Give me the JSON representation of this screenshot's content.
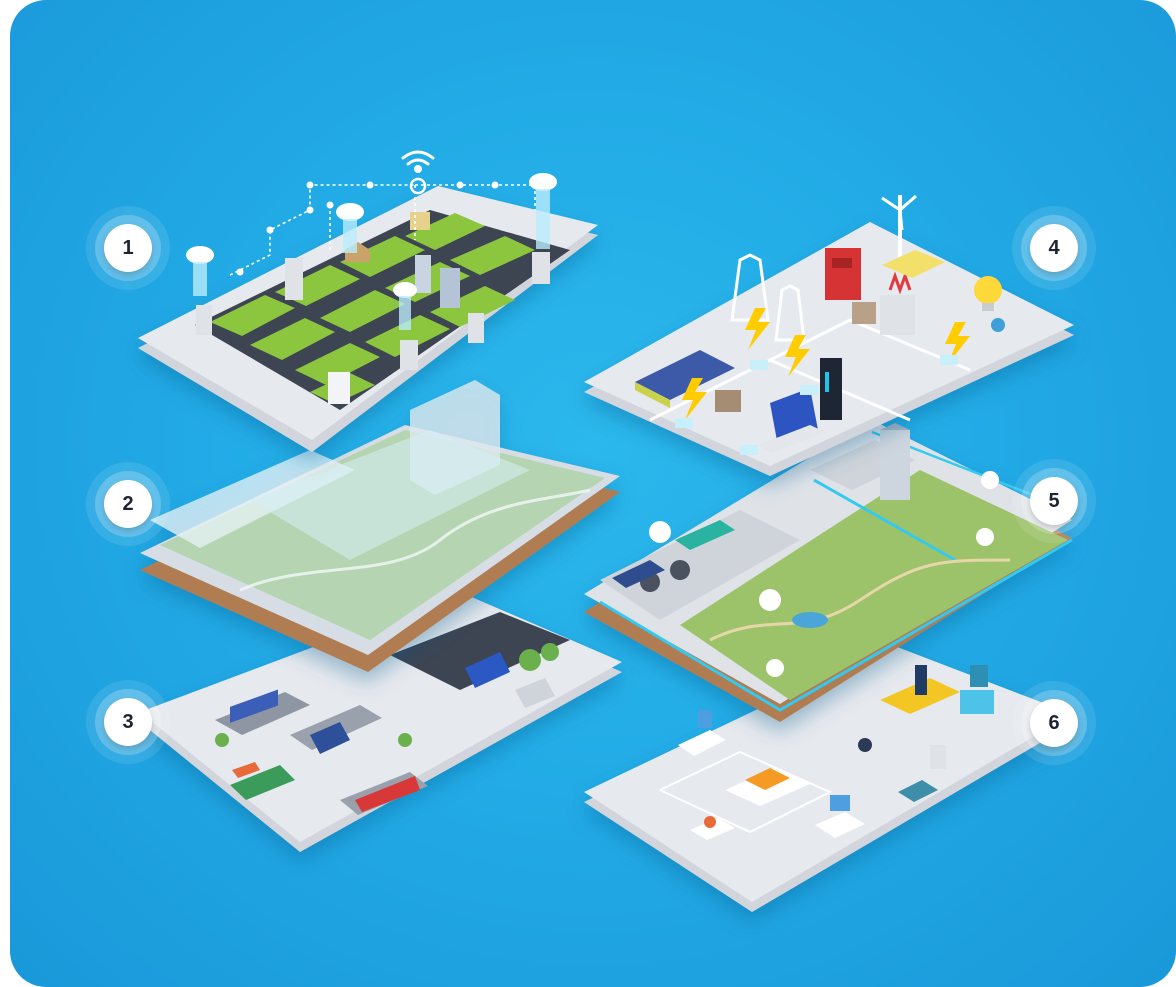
{
  "badges": {
    "b1": "1",
    "b2": "2",
    "b3": "3",
    "b4": "4",
    "b5": "5",
    "b6": "6"
  },
  "colors": {
    "background": "#22abe6",
    "platform": "#e6e9ee",
    "earth": "#b5845a",
    "grass": "#8cc63f",
    "road": "#3d4452",
    "accent_yellow": "#ffcc00",
    "accent_red": "#e03a3a",
    "accent_cyan": "#34c9f0"
  },
  "layers": [
    {
      "id": "1",
      "icon": "smart-city-icon"
    },
    {
      "id": "2",
      "icon": "environment-icon"
    },
    {
      "id": "3",
      "icon": "transportation-icon"
    },
    {
      "id": "4",
      "icon": "energy-icon"
    },
    {
      "id": "5",
      "icon": "parks-utilities-icon"
    },
    {
      "id": "6",
      "icon": "research-education-icon"
    }
  ]
}
